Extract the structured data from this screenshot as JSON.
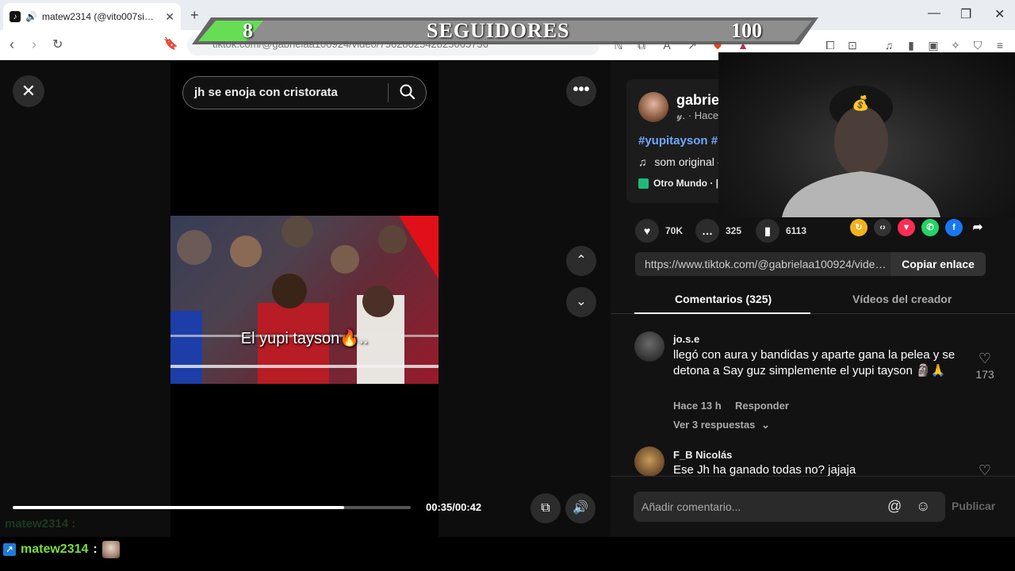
{
  "browser": {
    "tab_title": "matew2314 (@vito007simpat",
    "url": "tiktok.com/@gabrielaa100924/video/7562802542825065736"
  },
  "overlay": {
    "current": "8",
    "label": "SEGUIDORES",
    "goal": "100",
    "goal_fraction": 0.08
  },
  "player": {
    "search_query": "jh se enoja con cristorata",
    "caption": "El yupi tayson🔥..",
    "time": "00:35/00:42",
    "progress": 0.833
  },
  "post": {
    "author": "gabrie",
    "author_sub": "𝓎. · Hace",
    "hashtags": "#yupitayson #",
    "music": "som original -",
    "place": "Otro Mundo · |",
    "likes": "70K",
    "comments": "325",
    "saves": "6113",
    "link": "https://www.tiktok.com/@gabrielaa100924/video...",
    "copy_label": "Copiar enlace"
  },
  "tabs": {
    "comments": "Comentarios (325)",
    "creator_videos": "Vídeos del creador"
  },
  "comments": [
    {
      "user": "jo.s.e",
      "text": "llegó con aura y bandidas y aparte gana la pelea y se detona a Say guz simplemente el yupi tayson 🗿🙏",
      "time": "Hace 13 h",
      "reply": "Responder",
      "replies": "Ver 3 respuestas",
      "likes": "173"
    },
    {
      "user": "F_B Nicolás",
      "text": "Ese Jh ha ganado todas no? jajaja"
    }
  ],
  "composer": {
    "placeholder": "Añadir comentario...",
    "publish": "Publicar"
  },
  "chat": {
    "ghost": "matew2314 :",
    "user": "matew2314",
    "colon": ":"
  },
  "icons": [
    "speaker-icon",
    "bookmark-icon",
    "search-icon",
    "heart-icon",
    "comment-icon",
    "save-icon",
    "share-icon",
    "mention-icon",
    "emoji-icon"
  ]
}
